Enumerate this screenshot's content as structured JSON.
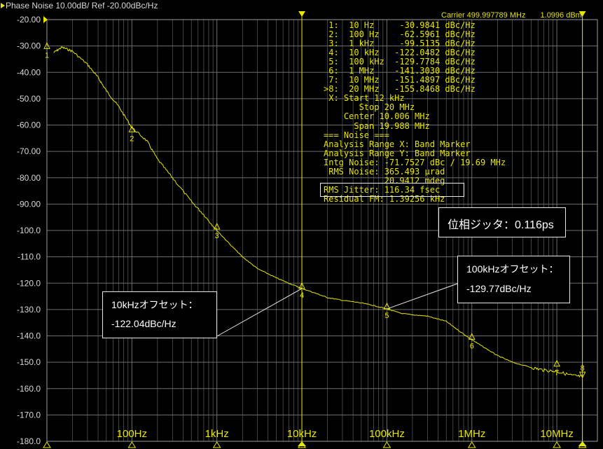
{
  "header": {
    "title": "Phase Noise 10.00dB/ Ref -20.00dBc/Hz"
  },
  "carrier": {
    "label": "Carrier 499.997789 MHz",
    "power": "1.0996 dBm"
  },
  "chart_data": {
    "type": "line",
    "x_scale": "log",
    "xlim": [
      10,
      30000000
    ],
    "ylim": [
      -180,
      -20
    ],
    "y_ticks": [
      -20,
      -30,
      -40,
      -50,
      -60,
      -70,
      -80,
      -90,
      -100,
      -110,
      -120,
      -130,
      -140,
      -150,
      -160,
      -170,
      -180
    ],
    "y_tick_labels": [
      "-20.00",
      "-30.00",
      "-40.00",
      "-50.00",
      "-60.00",
      "-70.00",
      "-80.00",
      "-90.00",
      "-100.0",
      "-110.0",
      "-120.0",
      "-130.0",
      "-140.0",
      "-150.0",
      "-160.0",
      "-170.0",
      "-180.0"
    ],
    "x_ticks": [
      100,
      1000,
      10000,
      100000,
      1000000,
      10000000
    ],
    "x_tick_labels": [
      "100Hz",
      "1kHz",
      "10kHz",
      "100kHz",
      "1MHz",
      "10MHz"
    ],
    "grid": true,
    "colors": {
      "trace": "#e6e600",
      "grid": "#6e6e6e",
      "axis_text": "#d8d8d8",
      "background": "#000000"
    },
    "series": [
      {
        "x": [
          12,
          15,
          20,
          30,
          40,
          50,
          70,
          100,
          150,
          200,
          300,
          500,
          700,
          1000,
          1500,
          2000,
          3000,
          5000,
          7000,
          10000,
          15000,
          20000,
          30000,
          50000,
          70000,
          100000,
          150000,
          200000,
          300000,
          500000,
          700000,
          1000000,
          1500000,
          2000000,
          3000000,
          5000000,
          7000000,
          10000000,
          15000000,
          20000000
        ],
        "y": [
          -32.5,
          -30.5,
          -32,
          -37,
          -42,
          -47,
          -53,
          -61,
          -66,
          -73,
          -80,
          -89,
          -94,
          -100,
          -106,
          -110,
          -114.5,
          -118,
          -120,
          -122,
          -124,
          -125.5,
          -126.5,
          -127.5,
          -128.5,
          -129.8,
          -131.5,
          -132,
          -132.5,
          -134.5,
          -138,
          -141.5,
          -145,
          -147.5,
          -150,
          -152,
          -153,
          -153.5,
          -155,
          -155.5
        ]
      }
    ],
    "markers": [
      {
        "label": "1",
        "x": 10,
        "y": -30.9841
      },
      {
        "label": "2",
        "x": 100,
        "y": -62.5961
      },
      {
        "label": "3",
        "x": 1000,
        "y": -99.5135
      },
      {
        "label": "4",
        "x": 10000,
        "y": -122.0482
      },
      {
        "label": "5",
        "x": 100000,
        "y": -129.7784
      },
      {
        "label": "6",
        "x": 1000000,
        "y": -141.303
      },
      {
        "label": "7",
        "x": 10000000,
        "y": -151.4897
      },
      {
        "label": "8",
        "x": 20000000,
        "y": -155.8468
      }
    ],
    "vertical_lines": [
      10000,
      20000000
    ]
  },
  "marker_table": [
    " 1:  10 Hz     -30.9841 dBc/Hz",
    " 2:  100 Hz    -62.5961 dBc/Hz",
    " 3:  1 kHz     -99.5135 dBc/Hz",
    " 4:  10 kHz   -122.0482 dBc/Hz",
    " 5:  100 kHz  -129.7784 dBc/Hz",
    " 6:  1 MHz    -141.3030 dBc/Hz",
    " 7:  10 MHz   -151.4897 dBc/Hz",
    ">8:  20 MHz   -155.8468 dBc/Hz",
    " X: Start 12 kHz",
    "       Stop 20 MHz",
    "    Center 10.006 MHz",
    "      Span 19.988 MHz",
    "=== Noise ===",
    "Analysis Range X: Band Marker",
    "Analysis Range Y: Band Marker",
    "Intg Noise: -71.7527 dBc / 19.69 MHz",
    " RMS Noise: 365.493 µrad",
    "            20.9412 mdeg",
    "RMS Jitter: 116.34 fsec",
    "Residual FM: 1.39256 kHz"
  ],
  "callouts": {
    "offset_10k_title": "10kHzオフセット：",
    "offset_10k_value": "-122.04dBc/Hz",
    "offset_100k_title": "100kHzオフセット：",
    "offset_100k_value": "-129.77dBc/Hz",
    "jitter": "位相ジッタ：0.116ps"
  }
}
